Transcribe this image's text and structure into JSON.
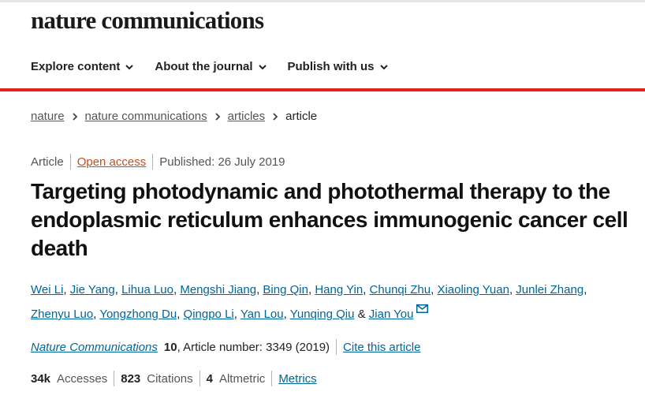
{
  "site": {
    "logo": "nature communications"
  },
  "nav": {
    "items": [
      {
        "label": "Explore content",
        "icon": "chevron-down-icon"
      },
      {
        "label": "About the journal",
        "icon": "chevron-down-icon"
      },
      {
        "label": "Publish with us",
        "icon": "chevron-down-icon"
      }
    ]
  },
  "breadcrumb": {
    "items": [
      "nature",
      "nature communications",
      "articles"
    ],
    "current": "article"
  },
  "meta": {
    "type": "Article",
    "access": "Open access",
    "published": "Published: 26 July 2019"
  },
  "article": {
    "title": "Targeting photodynamic and photothermal therapy to the endoplasmic reticulum enhances immunogenic cancer cell death"
  },
  "authors": [
    "Wei Li",
    "Jie Yang",
    "Lihua Luo",
    "Mengshi Jiang",
    "Bing Qin",
    "Hang Yin",
    "Chunqi Zhu",
    "Xiaoling Yuan",
    "Junlei Zhang",
    "Zhenyu Luo",
    "Yongzhong Du",
    "Qingpo Li",
    "Yan Lou",
    "Yunqing Qiu",
    "Jian You"
  ],
  "citation": {
    "journal": "Nature Communications",
    "volume": "10",
    "article_number": ", Article number: 3349 (2019)",
    "cite_label": "Cite this article"
  },
  "stats": {
    "accesses_value": "34k",
    "accesses_label": "Accesses",
    "citations_value": "823",
    "citations_label": "Citations",
    "altmetric_value": "4",
    "altmetric_label": "Altmetric",
    "metrics_label": "Metrics"
  },
  "colors": {
    "accent_red": "#e2231a",
    "link_blue": "#006699",
    "open_access": "#c0501e"
  }
}
